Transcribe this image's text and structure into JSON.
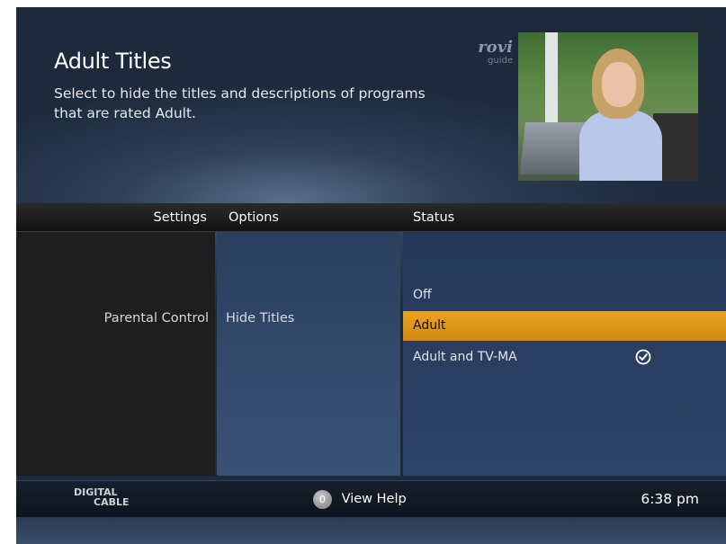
{
  "header": {
    "title": "Adult Titles",
    "description": "Select to hide the titles and descriptions of programs that are rated Adult.",
    "brand": {
      "name": "rovi",
      "sub": "guide"
    }
  },
  "columns": {
    "settings": "Settings",
    "options": "Options",
    "status": "Status"
  },
  "settings": {
    "selected": "Parental Control"
  },
  "options": {
    "selected": "Hide Titles"
  },
  "status": {
    "items": [
      {
        "label": "Off",
        "highlighted": false,
        "checked": false
      },
      {
        "label": "Adult",
        "highlighted": true,
        "checked": false
      },
      {
        "label": "Adult and TV-MA",
        "highlighted": false,
        "checked": true
      }
    ]
  },
  "footer": {
    "logo_line1": "DIGITAL",
    "logo_line2": "CABLE",
    "help_button": "0",
    "help_label": "View Help",
    "time": "6:38 pm"
  },
  "colors": {
    "highlight": "#e3991a",
    "panel_blue": "#2e4468",
    "settings_panel": "#1e1e1e",
    "header_bar": "#161616"
  },
  "icons": {
    "check": "check-circle-icon",
    "help": "remote-button-icon"
  }
}
